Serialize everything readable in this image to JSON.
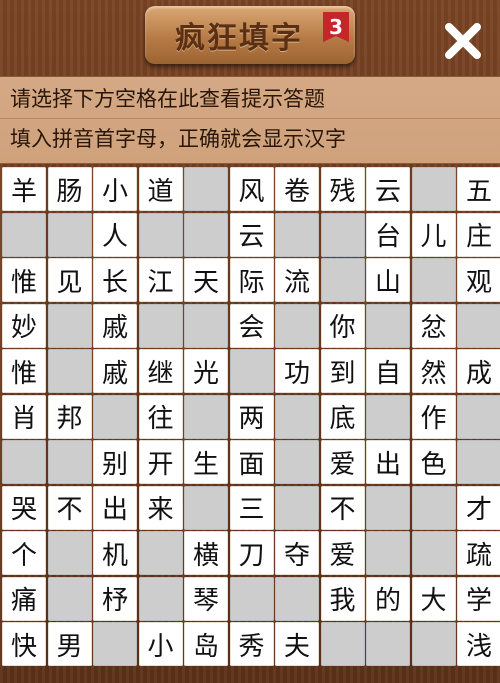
{
  "header": {
    "title": "疯狂填字",
    "level": "3",
    "close_icon": "close-x-icon"
  },
  "hint": {
    "line1": "请选择下方空格在此查看提示答题",
    "line2": "填入拼音首字母，正确就会显示汉字"
  },
  "colors": {
    "background": "#6b3a1f",
    "hint_panel": "#d4a985",
    "cell_filled": "#ffffff",
    "cell_empty": "#cdcdcd",
    "badge": "#c4262a"
  },
  "grid": {
    "rows": [
      [
        "羊",
        "肠",
        "小",
        "道",
        "",
        "风",
        "卷",
        "残",
        "云",
        "",
        "五"
      ],
      [
        "",
        "",
        "人",
        "",
        "",
        "云",
        "",
        "",
        "台",
        "儿",
        "庄"
      ],
      [
        "惟",
        "见",
        "长",
        "江",
        "天",
        "际",
        "流",
        "",
        "山",
        "",
        "观"
      ],
      [
        "妙",
        "",
        "戚",
        "",
        "",
        "会",
        "",
        "你",
        "",
        "忿",
        ""
      ],
      [
        "惟",
        "",
        "戚",
        "继",
        "光",
        "",
        "功",
        "到",
        "自",
        "然",
        "成"
      ],
      [
        "肖",
        "邦",
        "",
        "往",
        "",
        "两",
        "",
        "底",
        "",
        "作",
        ""
      ],
      [
        "",
        "",
        "别",
        "开",
        "生",
        "面",
        "",
        "爱",
        "出",
        "色",
        ""
      ],
      [
        "哭",
        "不",
        "出",
        "来",
        "",
        "三",
        "",
        "不",
        "",
        "",
        "才"
      ],
      [
        "个",
        "",
        "机",
        "",
        "横",
        "刀",
        "夺",
        "爱",
        "",
        "",
        "疏"
      ],
      [
        "痛",
        "",
        "杼",
        "",
        "琴",
        "",
        "",
        "我",
        "的",
        "大",
        "学"
      ],
      [
        "快",
        "男",
        "",
        "小",
        "岛",
        "秀",
        "夫",
        "",
        "",
        "",
        "浅"
      ]
    ],
    "white_mask": [
      [
        1,
        1,
        1,
        1,
        0,
        1,
        1,
        1,
        1,
        0,
        1
      ],
      [
        0,
        0,
        1,
        0,
        0,
        1,
        0,
        0,
        1,
        1,
        1
      ],
      [
        1,
        1,
        1,
        1,
        1,
        1,
        1,
        0,
        1,
        0,
        1
      ],
      [
        1,
        0,
        1,
        0,
        0,
        1,
        0,
        1,
        0,
        1,
        0
      ],
      [
        1,
        0,
        1,
        1,
        1,
        0,
        1,
        1,
        1,
        1,
        1
      ],
      [
        1,
        1,
        0,
        1,
        0,
        1,
        0,
        1,
        0,
        1,
        0
      ],
      [
        0,
        0,
        1,
        1,
        1,
        1,
        0,
        1,
        1,
        1,
        0
      ],
      [
        1,
        1,
        1,
        1,
        0,
        1,
        0,
        1,
        0,
        0,
        1
      ],
      [
        1,
        0,
        1,
        0,
        1,
        1,
        1,
        1,
        0,
        0,
        1
      ],
      [
        1,
        0,
        1,
        0,
        1,
        0,
        0,
        1,
        1,
        1,
        1
      ],
      [
        1,
        1,
        0,
        1,
        1,
        1,
        1,
        0,
        0,
        0,
        1
      ]
    ]
  }
}
